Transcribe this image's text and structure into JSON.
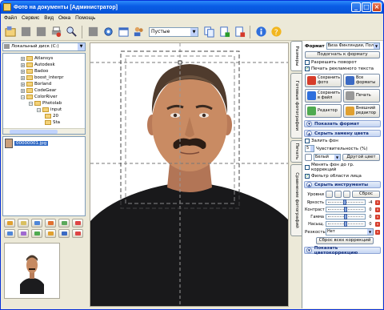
{
  "window": {
    "title": "Фото на документы [Администратор]"
  },
  "menu": [
    "Файл",
    "Сервис",
    "Вид",
    "Окна",
    "Помощь"
  ],
  "toolbar": {
    "preset_value": "Пустые"
  },
  "left": {
    "drive": "Локальный диск (C:)",
    "tree": [
      "Atlansys",
      "Autodesk",
      "Badoo",
      "boost_interpr",
      "Borland",
      "CodeGear",
      "ColorRiver",
      "Photolab",
      "input",
      "20",
      "Sta"
    ],
    "file": "00000001.jpg"
  },
  "tabs": [
    "Размеры",
    "Готовые фотографии",
    "Печать",
    "Сравнение фотографий"
  ],
  "right": {
    "format_label": "Формат",
    "format_value": "Виза Финляндии, Польш",
    "fit_button": "Подогнать к формату",
    "allow_rotate": "Разрешить поворот",
    "print_ad": "Печать рекламного текста",
    "save_photo": "Сохранить фото",
    "all_formats": "Все форматы",
    "save_file": "Сохранить в файл",
    "print": "Печать",
    "editor": "Редактор",
    "ext_editor": "Внешний редактор",
    "show_format": "Показать формат",
    "hide_bg": "Скрыть замену цвета",
    "fill_bg": "Залить фон",
    "sensitivity_value": "5",
    "sensitivity_label": "Чувствительность (%)",
    "color_value": "Белый",
    "other_color": "Другой цвет",
    "change_bg": "Менять фон до гр. коррекций",
    "face_filter": "Фильтр области лица",
    "hide_tools": "Скрыть инструменты",
    "levels": "Уровни",
    "reset": "Сброс",
    "brightness": "Яркость",
    "brightness_val": "-4",
    "contrast": "Контраст",
    "contrast_val": "0",
    "gamma": "Гамма",
    "gamma_val": "0",
    "saturation": "Насыщ.",
    "saturation_val": "0",
    "sharpness": "Резкость",
    "sharpness_value": "Нет",
    "reset_all": "Сброс всех коррекций",
    "show_color": "Показать цветокоррекцию"
  }
}
